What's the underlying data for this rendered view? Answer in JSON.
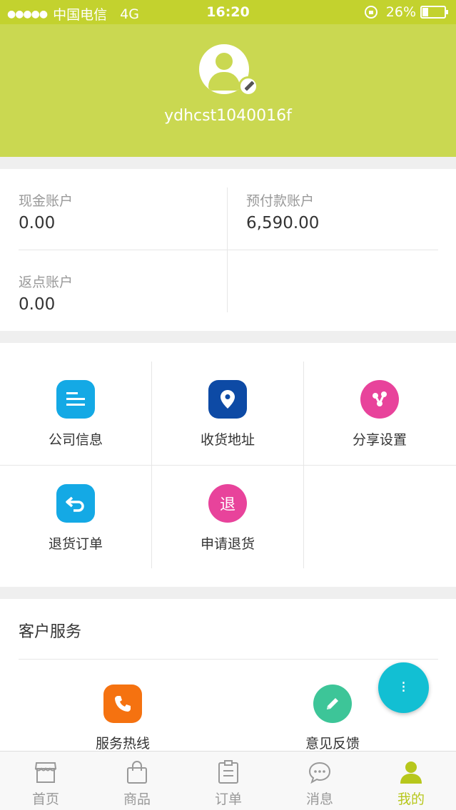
{
  "status_bar": {
    "signal": "●●●●●",
    "carrier": "中国电信",
    "network": "4G",
    "time": "16:20",
    "battery": "26%"
  },
  "profile": {
    "username": "ydhcst1040016f"
  },
  "accounts": [
    {
      "label": "现金账户",
      "value": "0.00"
    },
    {
      "label": "预付款账户",
      "value": "6,590.00"
    },
    {
      "label": "返点账户",
      "value": "0.00"
    }
  ],
  "functions": [
    {
      "label": "公司信息",
      "icon": "company-info-icon",
      "color": "#14a9e5"
    },
    {
      "label": "收货地址",
      "icon": "location-pin-icon",
      "color": "#0d4aa5"
    },
    {
      "label": "分享设置",
      "icon": "share-icon",
      "color": "#e8439b"
    },
    {
      "label": "退货订单",
      "icon": "return-arrow-icon",
      "color": "#14a9e5"
    },
    {
      "label": "申请退货",
      "icon": "return-request-icon",
      "glyph": "退",
      "color": "#e8439b"
    }
  ],
  "service": {
    "title": "客户服务",
    "items": [
      {
        "label": "服务热线",
        "icon": "phone-icon",
        "color": "#f57210"
      },
      {
        "label": "意见反馈",
        "icon": "pencil-icon",
        "color": "#3dc598"
      }
    ]
  },
  "fab": {
    "glyph": "⁝",
    "icon": "scroll-top-icon",
    "color": "#12bfd3"
  },
  "tabs": [
    {
      "label": "首页",
      "icon": "storefront-icon"
    },
    {
      "label": "商品",
      "icon": "shopping-bag-icon"
    },
    {
      "label": "订单",
      "icon": "clipboard-icon"
    },
    {
      "label": "消息",
      "icon": "chat-bubble-icon"
    },
    {
      "label": "我的",
      "icon": "user-icon",
      "active": true
    }
  ],
  "colors": {
    "header": "#cad851",
    "status_bar": "#c3d22e",
    "accent": "#b7c71c"
  }
}
